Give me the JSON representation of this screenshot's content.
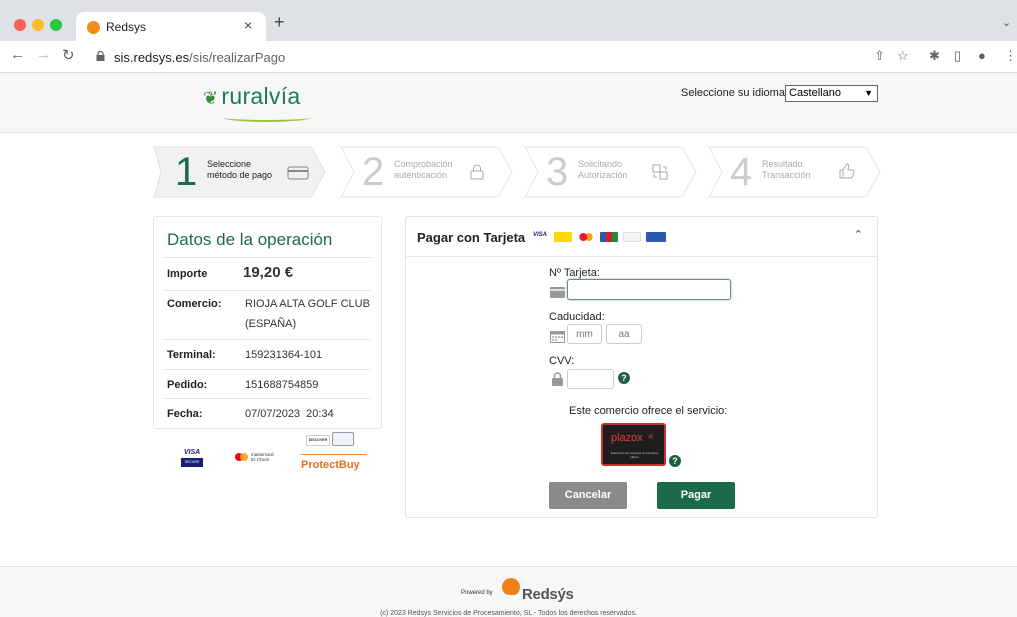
{
  "browser": {
    "tab_title": "Redsys",
    "tab_close": "×",
    "new_tab": "+",
    "url_host": "sis.redsys.es",
    "url_path": "/sis/realizarPago"
  },
  "header": {
    "logo_text": "ruralvía",
    "language_label": "Seleccione su idioma",
    "language_value": "Castellano"
  },
  "steps": [
    {
      "number": "1",
      "line1": "Seleccione",
      "line2": "método de pago",
      "icon": "card-icon",
      "active": true
    },
    {
      "number": "2",
      "line1": "Comprobación",
      "line2": "autenticación",
      "icon": "lock-icon",
      "active": false
    },
    {
      "number": "3",
      "line1": "Solicitando",
      "line2": "Autorización",
      "icon": "transfer-icon",
      "active": false
    },
    {
      "number": "4",
      "line1": "Resultado",
      "line2": "Transacción",
      "icon": "thumbs-up-icon",
      "active": false
    }
  ],
  "operation": {
    "title": "Datos de la operación",
    "importe_label": "Importe",
    "importe_value": "19,20 €",
    "comercio_label": "Comercio:",
    "comercio_value_1": "RIOJA ALTA GOLF CLUB",
    "comercio_value_2": "(ESPAÑA)",
    "terminal_label": "Terminal:",
    "terminal_value": "159231364-101",
    "pedido_label": "Pedido:",
    "pedido_value": "151688754859",
    "fecha_label": "Fecha:",
    "fecha_value": "07/07/2023  20:34"
  },
  "brands": {
    "visa": "VISA",
    "visa_secure": "SECURE",
    "mastercard_1": "mastercard",
    "mastercard_2": "ID Check",
    "discover": "DISCOVER",
    "protectbuy": "ProtectBuy"
  },
  "payment": {
    "title": "Pagar con Tarjeta",
    "visa_mini": "VISA",
    "card_label": "Nº Tarjeta:",
    "card_value": "",
    "expiry_label": "Caducidad:",
    "month_placeholder": "mm",
    "year_placeholder": "aa",
    "cvv_label": "CVV:",
    "cvv_value": "",
    "service_text": "Este comercio ofrece el servicio:",
    "plazox_text": "plazox",
    "plazox_sub": "Fracciona tus compras en cómodos plazos",
    "cancel_label": "Cancelar",
    "pay_label": "Pagar"
  },
  "footer": {
    "powered_by": "Powered by",
    "brand": "Redsýs",
    "copyright": "(c) 2023 Redsys Servicios de Procesamiento, SL - Todos los derechos reservados."
  },
  "colors": {
    "accent_green": "#1e6b4a",
    "pay_button": "#1b6b4a",
    "cancel_button": "#8a8a8a",
    "redsys_orange": "#f0801c"
  }
}
